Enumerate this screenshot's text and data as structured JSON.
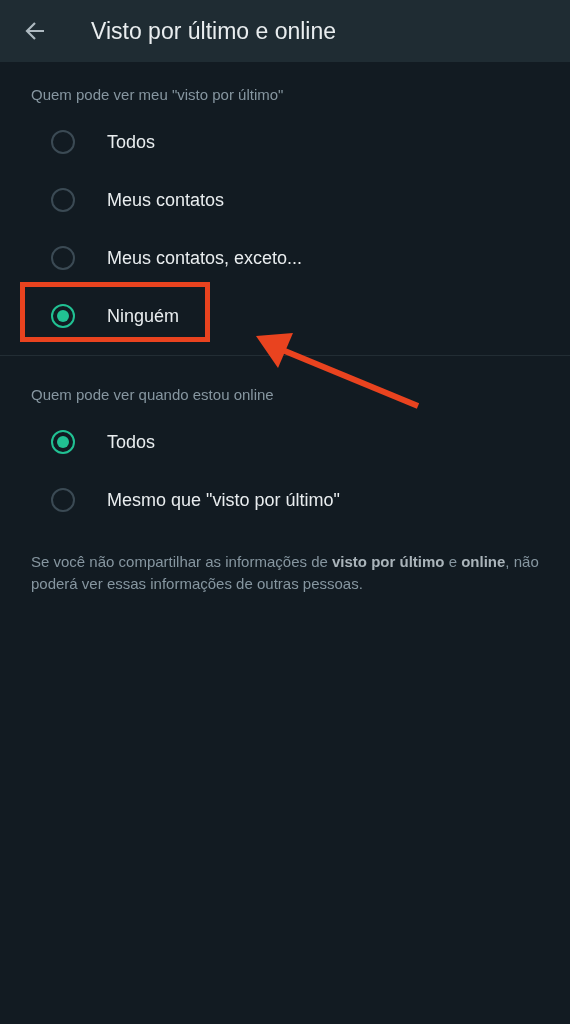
{
  "header": {
    "title": "Visto por último e online"
  },
  "sections": [
    {
      "title": "Quem pode ver meu \"visto por último\"",
      "options": [
        {
          "label": "Todos",
          "selected": false,
          "highlighted": false
        },
        {
          "label": "Meus contatos",
          "selected": false,
          "highlighted": false
        },
        {
          "label": "Meus contatos, exceto...",
          "selected": false,
          "highlighted": false
        },
        {
          "label": "Ninguém",
          "selected": true,
          "highlighted": true
        }
      ]
    },
    {
      "title": "Quem pode ver quando estou online",
      "options": [
        {
          "label": "Todos",
          "selected": true,
          "highlighted": false
        },
        {
          "label": "Mesmo que \"visto por último\"",
          "selected": false,
          "highlighted": false
        }
      ]
    }
  ],
  "note": "Se você não compartilhar as informações de **visto por último** e **online**, não poderá ver essas informações de outras pessoas."
}
